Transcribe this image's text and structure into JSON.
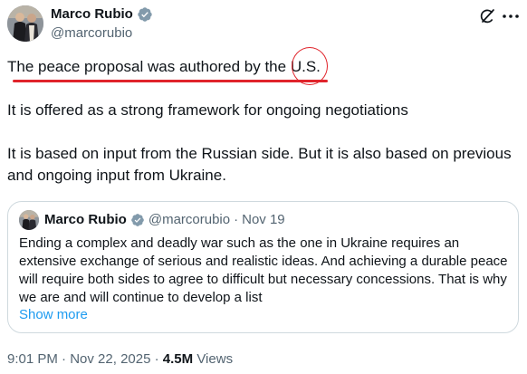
{
  "author": {
    "name": "Marco Rubio",
    "handle": "@marcorubio"
  },
  "tweet": {
    "paragraphs": [
      "The peace proposal was authored by the U.S.",
      "It is offered as a strong framework for ongoing negotiations",
      "It is based on input from the Russian side. But it is also based on previous and ongoing input from Ukraine."
    ],
    "annotation_color": "#e0242b"
  },
  "quote": {
    "name": "Marco Rubio",
    "handle": "@marcorubio",
    "separator": "·",
    "date": "Nov 19",
    "text": "Ending a complex and deadly war such as the one in Ukraine requires an extensive exchange of serious and realistic ideas. And achieving a durable peace will require both sides to agree to difficult but necessary concessions. That is why we are and will continue to develop a list",
    "show_more": "Show more"
  },
  "meta": {
    "time": "9:01 PM",
    "separator1": "·",
    "date": "Nov 22, 2025",
    "separator2": "·",
    "views_count": "4.5M",
    "views_label": "Views"
  },
  "colors": {
    "verified_badge": "#829aab",
    "link": "#1d9bf0",
    "secondary_text": "#536471"
  },
  "icons": [
    "verified-badge-icon",
    "grok-icon",
    "more-icon"
  ]
}
